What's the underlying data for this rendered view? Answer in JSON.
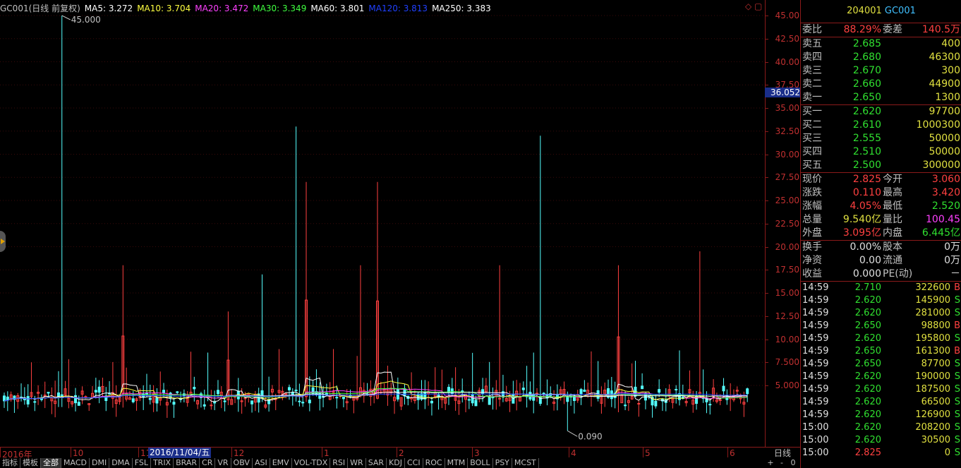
{
  "chart": {
    "ma_header": [
      {
        "text": "GC001(日线 前复权)",
        "color": "#c0c0c0"
      },
      {
        "text": "MA5: 3.272",
        "color": "#ffffff"
      },
      {
        "text": "MA10: 3.704",
        "color": "#ffff40"
      },
      {
        "text": "MA20: 3.472",
        "color": "#ff40ff"
      },
      {
        "text": "MA30: 3.349",
        "color": "#40ff40"
      },
      {
        "text": "MA60: 3.801",
        "color": "#ffffff"
      },
      {
        "text": "MA120: 3.813",
        "color": "#2040ff"
      },
      {
        "text": "MA250: 3.383",
        "color": "#ffffff"
      }
    ],
    "top_icons": "◇ ▢",
    "max_label": "45.000",
    "min_label": "0.090",
    "y_ticks": [
      "45.00",
      "42.50",
      "40.00",
      "37.50",
      "35.00",
      "32.50",
      "30.00",
      "27.50",
      "25.00",
      "22.50",
      "20.00",
      "17.50",
      "15.00",
      "12.50",
      "10.00",
      "7.500",
      "5.000"
    ],
    "y_current": "36.052",
    "x_ticks": [
      "2016年",
      "10",
      "11",
      "12",
      "1",
      "2",
      "3",
      "4",
      "5",
      "6"
    ],
    "x_cursor": "2016/11/04/五",
    "period": "日线",
    "up_color": "#ff4040",
    "down_color": "#54ffff",
    "tabs": [
      "指标",
      "模板",
      "全部",
      "MACD",
      "DMI",
      "DMA",
      "FSL",
      "TRIX",
      "BRAR",
      "CR",
      "VR",
      "OBV",
      "ASI",
      "EMV",
      "VOL-TDX",
      "RSI",
      "WR",
      "SAR",
      "KDJ",
      "CCI",
      "ROC",
      "MTM",
      "BOLL",
      "PSY",
      "MCST"
    ],
    "active_tab": "全部",
    "zoom": [
      "+",
      "-",
      "0"
    ]
  },
  "panel": {
    "code": "204001",
    "name": "GC001",
    "weibi_label": "委比",
    "weibi": "88.29%",
    "weicha_label": "委差",
    "weicha": "140.5万",
    "sell": [
      {
        "label": "卖五",
        "price": "2.685",
        "vol": "400"
      },
      {
        "label": "卖四",
        "price": "2.680",
        "vol": "46300"
      },
      {
        "label": "卖三",
        "price": "2.670",
        "vol": "300"
      },
      {
        "label": "卖二",
        "price": "2.660",
        "vol": "44900"
      },
      {
        "label": "卖一",
        "price": "2.650",
        "vol": "1300"
      }
    ],
    "buy": [
      {
        "label": "买一",
        "price": "2.620",
        "vol": "97700"
      },
      {
        "label": "买二",
        "price": "2.610",
        "vol": "1000300"
      },
      {
        "label": "买三",
        "price": "2.555",
        "vol": "50000"
      },
      {
        "label": "买四",
        "price": "2.510",
        "vol": "50000"
      },
      {
        "label": "买五",
        "price": "2.500",
        "vol": "300000"
      }
    ],
    "quote": [
      {
        "l1": "现价",
        "v1": "2.825",
        "c1": "red",
        "l2": "今开",
        "v2": "3.060",
        "c2": "red"
      },
      {
        "l1": "涨跌",
        "v1": "0.110",
        "c1": "red",
        "l2": "最高",
        "v2": "3.420",
        "c2": "red"
      },
      {
        "l1": "涨幅",
        "v1": "4.05%",
        "c1": "red",
        "l2": "最低",
        "v2": "2.520",
        "c2": "grn"
      },
      {
        "l1": "总量",
        "v1": "9.540亿",
        "c1": "yel",
        "l2": "量比",
        "v2": "100.45",
        "c2": "mag"
      },
      {
        "l1": "外盘",
        "v1": "3.095亿",
        "c1": "red",
        "l2": "内盘",
        "v2": "6.445亿",
        "c2": "grn"
      }
    ],
    "info": [
      {
        "l1": "换手",
        "v1": "0.00%",
        "l2": "股本",
        "v2": "0万"
      },
      {
        "l1": "净资",
        "v1": "0.00",
        "l2": "流通",
        "v2": "0万"
      },
      {
        "l1": "收益",
        "v1": "0.000",
        "l2": "PE(动)",
        "v2": "－"
      }
    ],
    "ticks": [
      {
        "time": "14:59",
        "price": "2.710",
        "pc": "grn",
        "vol": "322600",
        "bs": "B"
      },
      {
        "time": "14:59",
        "price": "2.620",
        "pc": "grn",
        "vol": "145900",
        "bs": "S"
      },
      {
        "time": "14:59",
        "price": "2.620",
        "pc": "grn",
        "vol": "281000",
        "bs": "S"
      },
      {
        "time": "14:59",
        "price": "2.650",
        "pc": "grn",
        "vol": "98800",
        "bs": "B"
      },
      {
        "time": "14:59",
        "price": "2.620",
        "pc": "grn",
        "vol": "195800",
        "bs": "S"
      },
      {
        "time": "14:59",
        "price": "2.650",
        "pc": "grn",
        "vol": "161300",
        "bs": "B"
      },
      {
        "time": "14:59",
        "price": "2.650",
        "pc": "grn",
        "vol": "87700",
        "bs": "S"
      },
      {
        "time": "14:59",
        "price": "2.620",
        "pc": "grn",
        "vol": "190000",
        "bs": "S"
      },
      {
        "time": "14:59",
        "price": "2.620",
        "pc": "grn",
        "vol": "187500",
        "bs": "S"
      },
      {
        "time": "14:59",
        "price": "2.620",
        "pc": "grn",
        "vol": "66500",
        "bs": "S"
      },
      {
        "time": "14:59",
        "price": "2.620",
        "pc": "grn",
        "vol": "126900",
        "bs": "S"
      },
      {
        "time": "15:00",
        "price": "2.620",
        "pc": "grn",
        "vol": "208200",
        "bs": "S"
      },
      {
        "time": "15:00",
        "price": "2.620",
        "pc": "grn",
        "vol": "30500",
        "bs": "S"
      },
      {
        "time": "15:00",
        "price": "2.825",
        "pc": "red",
        "vol": "0",
        "bs": "S"
      }
    ]
  }
}
